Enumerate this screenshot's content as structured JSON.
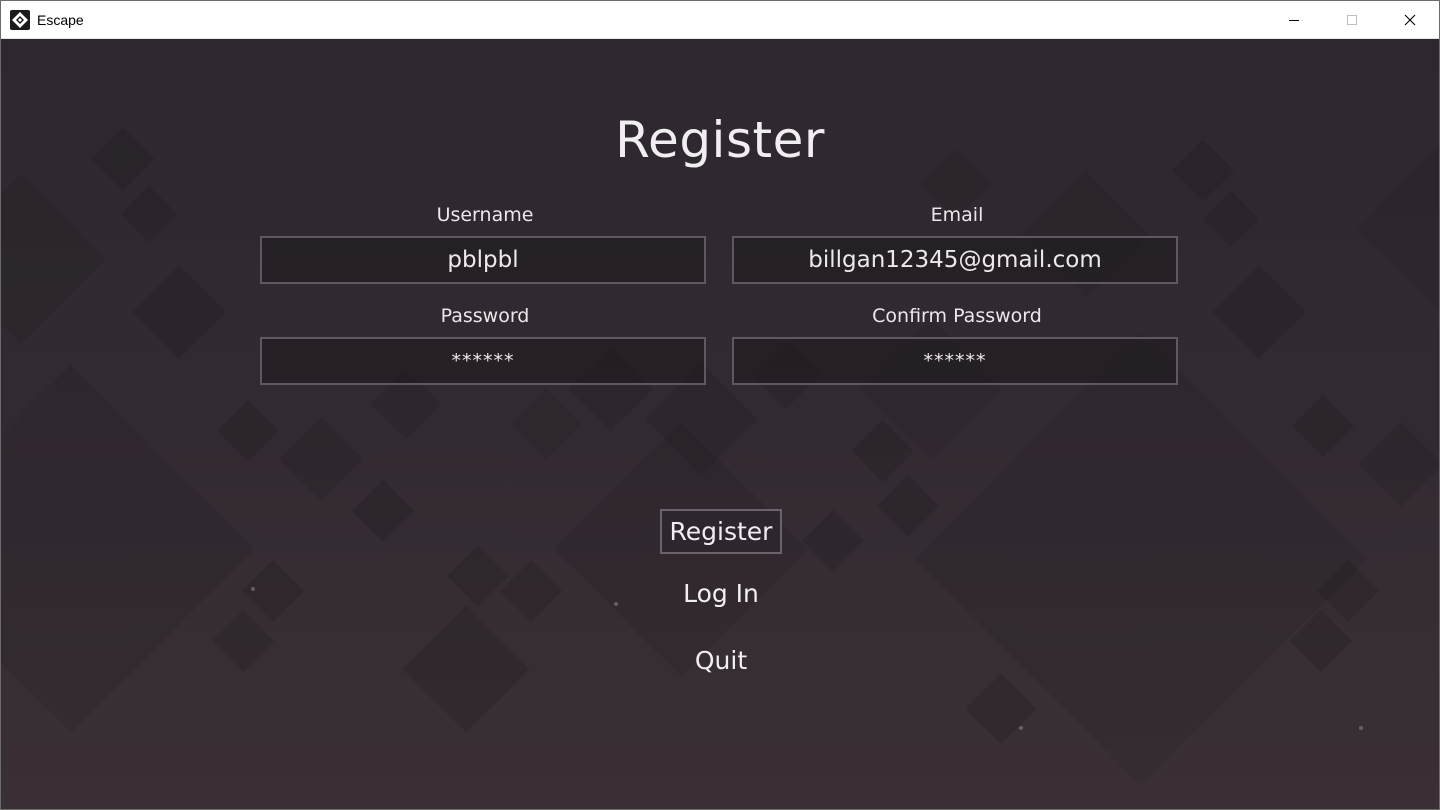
{
  "window": {
    "title": "Escape",
    "app_icon": "escape-logo-icon",
    "controls": [
      "minimize-icon",
      "maximize-icon",
      "close-icon"
    ]
  },
  "page": {
    "heading": "Register"
  },
  "form": {
    "username": {
      "label": "Username",
      "value": "pblpbl"
    },
    "email": {
      "label": "Email",
      "value": "billgan12345@gmail.com"
    },
    "password": {
      "label": "Password",
      "value": "******"
    },
    "confirm_password": {
      "label": "Confirm Password",
      "value": "******"
    }
  },
  "actions": {
    "register_label": "Register",
    "login_label": "Log In",
    "quit_label": "Quit"
  },
  "colors": {
    "background": "#2e2830",
    "text": "#f1eef1",
    "field_border": "#5e5860",
    "titlebar": "#ffffff"
  }
}
